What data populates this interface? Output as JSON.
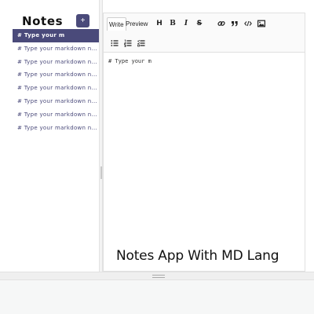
{
  "sidebar": {
    "title": "Notes",
    "add_label": "+",
    "notes": [
      "# Type your m",
      "# Type your markdown note's title here",
      "# Type your markdown note's title here",
      "# Type your markdown note's title here",
      "# Type your markdown note's title here",
      "# Type your markdown note's title here",
      "# Type your markdown note's title here",
      "# Type your markdown note's title here"
    ],
    "active_index": 0
  },
  "editor": {
    "tabs": {
      "write": "Write",
      "preview": "Preview"
    },
    "toolbar_icons": [
      "header-icon",
      "bold-icon",
      "italic-icon",
      "strikethrough-icon",
      "link-icon",
      "quote-icon",
      "code-icon",
      "image-icon",
      "unordered-list-icon",
      "ordered-list-icon",
      "checklist-icon"
    ],
    "tools": {
      "header": "H",
      "bold": "B",
      "italic": "I",
      "strike": "S"
    },
    "content": "# Type your m"
  },
  "overlay": {
    "caption": "Notes App With MD Lang"
  },
  "colors": {
    "accent": "#4a4a7a"
  }
}
